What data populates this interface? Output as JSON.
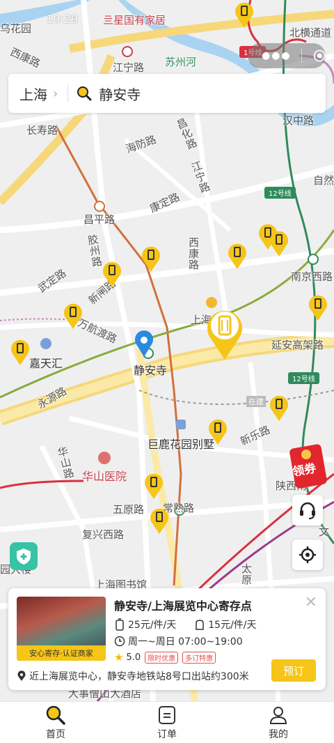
{
  "status_bar": {
    "time": "10:29"
  },
  "search": {
    "city": "上海",
    "query": "静安寺"
  },
  "map": {
    "poi_labels": [
      "乌花园",
      "西康路",
      "江宁路",
      "苏州河",
      "北横通道",
      "长寿路",
      "海防路",
      "昌化路",
      "汉中路",
      "江宁路",
      "自然",
      "昌平路",
      "康定路",
      "胶州路",
      "西康路",
      "南京西路",
      "武定路",
      "新闸路",
      "上海",
      "康定路",
      "万航渡路",
      "嘉天汇",
      "静安寺",
      "延安高架路",
      "永源路",
      "在建",
      "新乐路",
      "巨鹿花园别墅",
      "华山医院",
      "华山路",
      "陕西南",
      "五原路",
      "常熟路",
      "复兴西路",
      "上海图书馆",
      "太原",
      "园大楼",
      "大事僧山大酒店",
      "文"
    ],
    "line_badges": [
      {
        "text": "1号线",
        "color": "#d9303f"
      },
      {
        "text": "12号线",
        "color": "#2f8a5c"
      },
      {
        "text": "12号线",
        "color": "#2f8a5c"
      }
    ],
    "top_shop": "亖星国有家居"
  },
  "coupon": {
    "label": "领券"
  },
  "card": {
    "title": "静安寺/上海展览中心寄存点",
    "badge": "安心寄存·认证商家",
    "price_large": "25元/件/天",
    "price_small": "15元/件/天",
    "hours": "周一~周日 07:00~19:00",
    "rating": "5.0",
    "tags": [
      "限时优惠",
      "多订特惠"
    ],
    "address": "近上海展览中心，静安寺地铁站8号口出站约300米",
    "book_label": "预订",
    "accent": "#f5c518"
  },
  "tabs": [
    {
      "label": "首页",
      "icon": "search-icon"
    },
    {
      "label": "订单",
      "icon": "order-icon"
    },
    {
      "label": "我的",
      "icon": "profile-icon"
    }
  ]
}
